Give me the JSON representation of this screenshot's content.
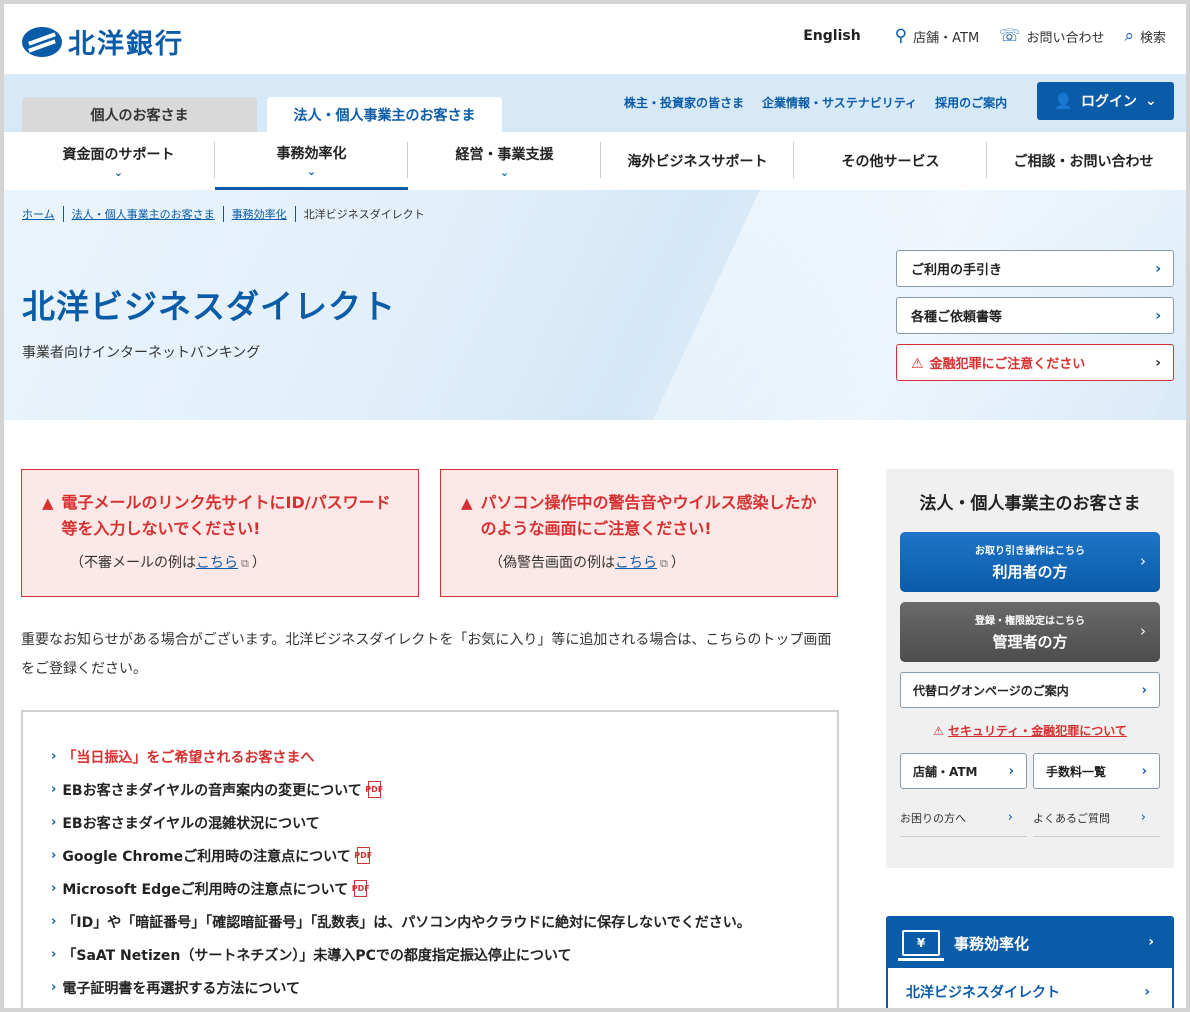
{
  "header": {
    "logo_text": "北洋銀行",
    "english": "English",
    "store_atm": "店舗・ATM",
    "contact": "お問い合わせ",
    "search": "検索"
  },
  "band": {
    "tab_personal": "個人のお客さま",
    "tab_corporate": "法人・個人事業主のお客さま",
    "links": [
      "株主・投資家の皆さま",
      "企業情報・サステナビリティ",
      "採用のご案内"
    ],
    "login": "ログイン"
  },
  "mainnav": [
    {
      "label": "資金面のサポート",
      "has_dropdown": true
    },
    {
      "label": "事務効率化",
      "has_dropdown": true
    },
    {
      "label": "経営・事業支援",
      "has_dropdown": true
    },
    {
      "label": "海外ビジネスサポート",
      "has_dropdown": false
    },
    {
      "label": "その他サービス",
      "has_dropdown": false
    },
    {
      "label": "ご相談・お問い合わせ",
      "has_dropdown": false
    }
  ],
  "breadcrumb": [
    "ホーム",
    "法人・個人事業主のお客さま",
    "事務効率化"
  ],
  "breadcrumb_current": "北洋ビジネスダイレクト",
  "hero": {
    "title": "北洋ビジネスダイレクト",
    "subtitle": "事業者向けインターネットバンキング",
    "btn_guide": "ご利用の手引き",
    "btn_forms": "各種ご依頼書等",
    "btn_fraud": "金融犯罪にご注意ください"
  },
  "alerts": [
    {
      "title": "電子メールのリンク先サイトにID/パスワード等を入力しないでください!",
      "note_pre": "（不審メールの例は",
      "link": "こちら",
      "note_post": "）"
    },
    {
      "title": "パソコン操作中の警告音やウイルス感染したかのような画面にご注意ください!",
      "note_pre": "（偽警告画面の例は",
      "link": "こちら",
      "note_post": "）"
    }
  ],
  "notice": "重要なお知らせがある場合がございます。北洋ビジネスダイレクトを「お気に入り」等に追加される場合は、こちらのトップ画面をご登録ください。",
  "news": [
    {
      "label": "「当日振込」をご希望されるお客さまへ",
      "red": true,
      "pdf": false
    },
    {
      "label": "EBお客さまダイヤルの音声案内の変更について",
      "red": false,
      "pdf": true
    },
    {
      "label": "EBお客さまダイヤルの混雑状況について",
      "red": false,
      "pdf": false
    },
    {
      "label": "Google Chromeご利用時の注意点について",
      "red": false,
      "pdf": true
    },
    {
      "label": "Microsoft Edgeご利用時の注意点について",
      "red": false,
      "pdf": true
    },
    {
      "label": "「ID」や「暗証番号」「確認暗証番号」「乱数表」は、パソコン内やクラウドに絶対に保存しないでください。",
      "red": false,
      "pdf": false
    },
    {
      "label": "「SaAT Netizen（サートネチズン）」未導入PCでの都度指定振込停止について",
      "red": false,
      "pdf": false
    },
    {
      "label": "電子証明書を再選択する方法について",
      "red": false,
      "pdf": false
    }
  ],
  "pdf_label": "PDF",
  "sidebar": {
    "title": "法人・個人事業主のお客さま",
    "user_small": "お取り引き操作はこちら",
    "user_large": "利用者の方",
    "admin_small": "登録・権限設定はこちら",
    "admin_large": "管理者の方",
    "alt_login": "代替ログオンページのご案内",
    "security": "セキュリティ・金融犯罪について",
    "store_atm": "店舗・ATM",
    "fees": "手数料一覧",
    "help": "お困りの方へ",
    "faq": "よくあるご質問"
  },
  "category": {
    "head": "事務効率化",
    "item": "北洋ビジネスダイレクト"
  },
  "colors": {
    "brand": "#0a5ba8",
    "alert": "#d73030",
    "alert_bg": "#fde8e8"
  }
}
